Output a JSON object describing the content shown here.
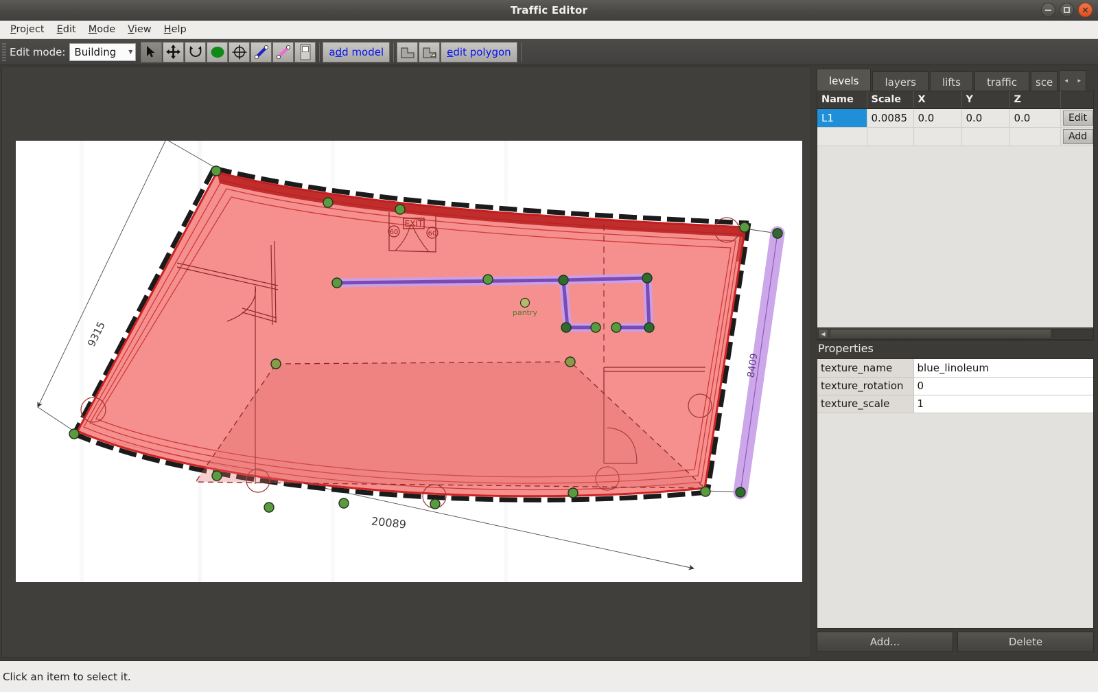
{
  "window": {
    "title": "Traffic Editor",
    "controls": [
      {
        "name": "minimize",
        "glyph": "minimize-icon"
      },
      {
        "name": "maximize",
        "glyph": "maximize-icon"
      },
      {
        "name": "close",
        "glyph": "close-icon"
      }
    ]
  },
  "menubar": {
    "items": [
      {
        "label": "Project",
        "mnemonic": "P",
        "rest": "roject"
      },
      {
        "label": "Edit",
        "mnemonic": "E",
        "rest": "dit"
      },
      {
        "label": "Mode",
        "mnemonic": "M",
        "rest": "ode"
      },
      {
        "label": "View",
        "mnemonic": "V",
        "rest": "iew"
      },
      {
        "label": "Help",
        "mnemonic": "H",
        "rest": "elp"
      }
    ]
  },
  "toolbar": {
    "edit_mode_label": "Edit mode:",
    "edit_mode_value": "Building",
    "edit_mode_options": [
      "Building"
    ],
    "tools": [
      {
        "name": "select-arrow-tool",
        "icon": "cursor-arrow-icon",
        "checked": true
      },
      {
        "name": "move-tool",
        "icon": "move-cross-arrows-icon",
        "checked": false
      },
      {
        "name": "rotate-tool",
        "icon": "rotate-arrow-icon",
        "checked": false
      },
      {
        "name": "add-vertex-tool",
        "icon": "green-circle-icon",
        "checked": false
      },
      {
        "name": "add-fiducial-tool",
        "icon": "crosshair-circle-icon",
        "checked": false
      },
      {
        "name": "add-lane-tool",
        "icon": "blue-line-icon",
        "checked": false
      },
      {
        "name": "add-wall-tool",
        "icon": "pink-line-icon",
        "checked": false
      },
      {
        "name": "add-door-tool",
        "icon": "door-icon",
        "checked": false
      }
    ],
    "add_model_label": "add model",
    "add_model_mnemonic": "d",
    "add_floor_name": "add-floor-tool",
    "add_floor_icon": "polygon-floor-icon",
    "edit_polygon_name": "edit-polygon-tool",
    "edit_polygon_icon": "polygon-edit-icon",
    "edit_polygon_label": "edit polygon",
    "edit_polygon_mnemonic": "e"
  },
  "dock": {
    "tabs": [
      {
        "label": "levels",
        "active": true
      },
      {
        "label": "layers",
        "active": false
      },
      {
        "label": "lifts",
        "active": false
      },
      {
        "label": "traffic",
        "active": false
      },
      {
        "label": "sce",
        "active": false,
        "clipped": true
      }
    ],
    "tab_scroll_left": "◂",
    "tab_scroll_right": "▸",
    "levels_table": {
      "columns": [
        "Name",
        "Scale",
        "X",
        "Y",
        "Z",
        ""
      ],
      "rows": [
        {
          "name": "L1",
          "scale": "0.0085",
          "x": "0.0",
          "y": "0.0",
          "z": "0.0",
          "button": "Edit",
          "selected": true
        },
        {
          "name": "",
          "scale": "",
          "x": "",
          "y": "",
          "z": "",
          "button": "Add",
          "selected": false
        }
      ]
    },
    "properties_title": "Properties",
    "properties": [
      {
        "key": "texture_name",
        "value": "blue_linoleum"
      },
      {
        "key": "texture_rotation",
        "value": "0"
      },
      {
        "key": "texture_scale",
        "value": "1"
      }
    ],
    "add_button": "Add...",
    "delete_button": "Delete"
  },
  "canvas": {
    "dimension_labels": [
      {
        "text": "9315",
        "name": "dimension-left"
      },
      {
        "text": "8409",
        "name": "dimension-right"
      },
      {
        "text": "20089",
        "name": "dimension-bottom"
      }
    ],
    "plan_labels": [
      {
        "text": "EXIT",
        "name": "exit-sign-label"
      },
      {
        "text": "pantry",
        "name": "pantry-vertex-label"
      }
    ],
    "colors": {
      "floor_fill": "#f47e7e",
      "floor_edge": "#cc1f1f",
      "wall_purple": "#7b4bb5",
      "measurement_purple": "#b488dd",
      "vertex_green": "#3f8b3f",
      "selected_blue": "#1f90d8"
    }
  },
  "statusbar": {
    "message": "Click an item to select it."
  }
}
